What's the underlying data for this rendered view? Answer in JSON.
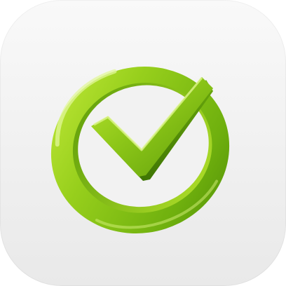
{
  "app_icon": {
    "icon": "green-3d-checkmark-in-circle-icon",
    "colors": {
      "background_top": "#f9f9f9",
      "background_bottom": "#e9e9e9",
      "green_light": "#b9e52f",
      "green_mid": "#8cc618",
      "green_dark": "#4e8c06"
    }
  }
}
